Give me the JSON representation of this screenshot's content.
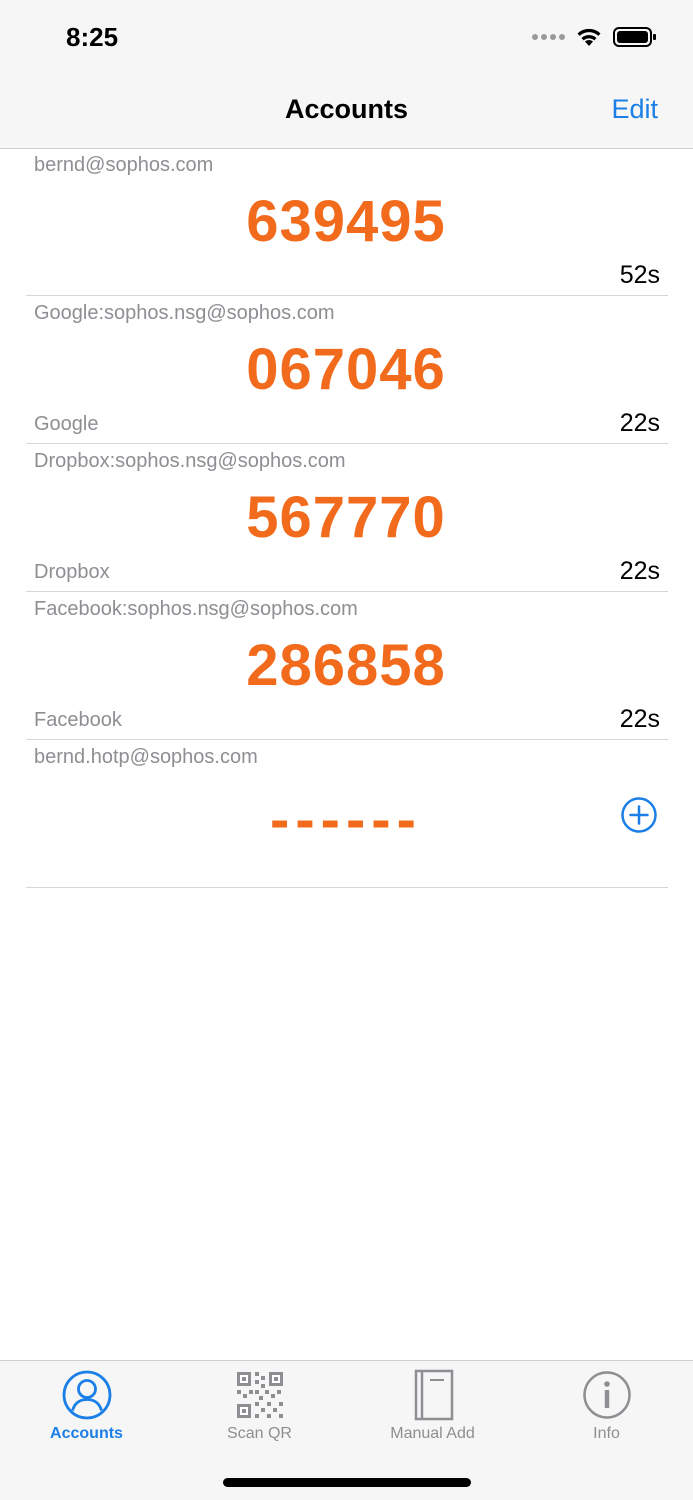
{
  "status": {
    "time": "8:25"
  },
  "nav": {
    "title": "Accounts",
    "edit_label": "Edit"
  },
  "accounts": [
    {
      "name": "bernd@sophos.com",
      "code": "639495",
      "issuer": "",
      "timer": "52s"
    },
    {
      "name": "Google:sophos.nsg@sophos.com",
      "code": "067046",
      "issuer": "Google",
      "timer": "22s"
    },
    {
      "name": "Dropbox:sophos.nsg@sophos.com",
      "code": "567770",
      "issuer": "Dropbox",
      "timer": "22s"
    },
    {
      "name": "Facebook:sophos.nsg@sophos.com",
      "code": "286858",
      "issuer": "Facebook",
      "timer": "22s"
    },
    {
      "name": "bernd.hotp@sophos.com",
      "code": "------",
      "issuer": "",
      "timer": ""
    }
  ],
  "tabs": [
    {
      "label": "Accounts",
      "icon": "person-circle-icon",
      "active": true
    },
    {
      "label": "Scan QR",
      "icon": "qr-code-icon",
      "active": false
    },
    {
      "label": "Manual Add",
      "icon": "notebook-icon",
      "active": false
    },
    {
      "label": "Info",
      "icon": "info-circle-icon",
      "active": false
    }
  ],
  "colors": {
    "accent": "#1a7fe6",
    "code": "#f26b1d",
    "secondary_text": "#8e8e93"
  }
}
